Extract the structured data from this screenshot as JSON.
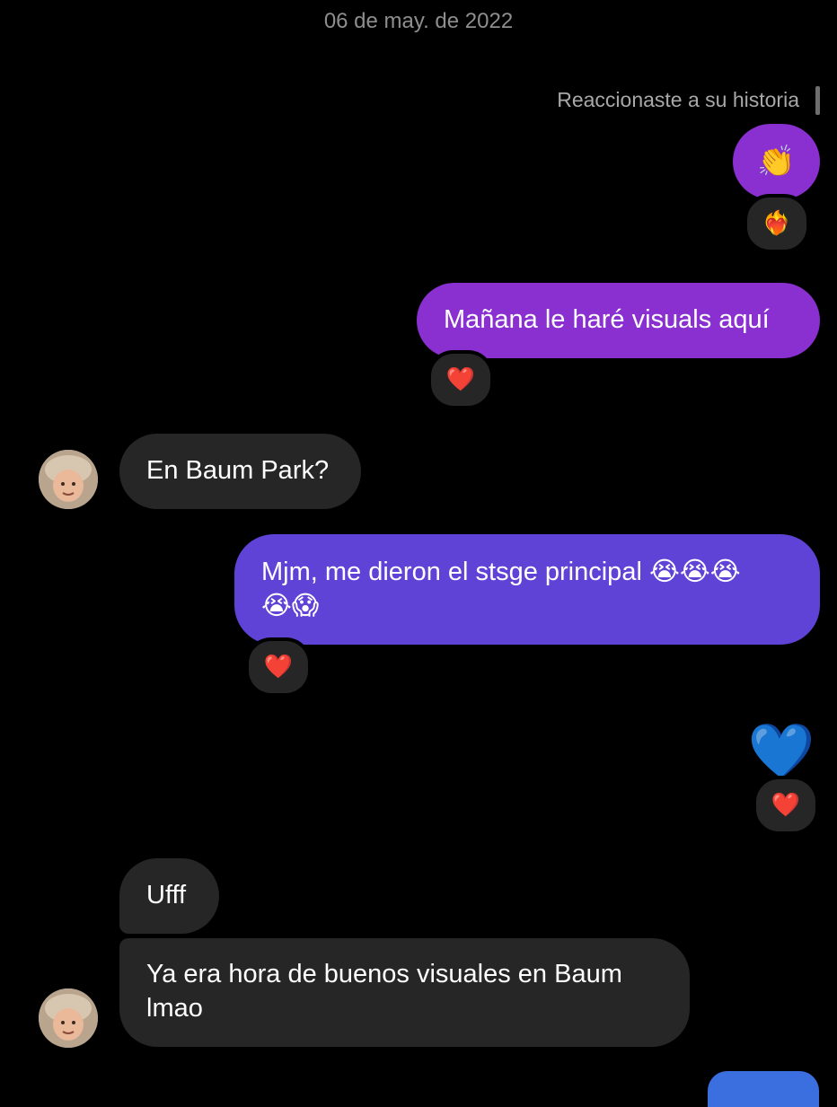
{
  "header": {
    "date": "06 de may. de 2022"
  },
  "story_reply": {
    "note": "Reaccionaste a su historia",
    "emoji": "👏",
    "reaction": "❤️‍🔥"
  },
  "messages": [
    {
      "side": "sent",
      "text": "Mañana le haré visuals aquí",
      "reaction": "❤️"
    },
    {
      "side": "received",
      "text": "En Baum Park?"
    },
    {
      "side": "sent",
      "text_line1": "Mjm, me dieron el stsge principal 😭😭😭",
      "text_line2": "😭😱",
      "reaction": "❤️"
    },
    {
      "side": "sent",
      "emoji": "💙",
      "reaction": "❤️"
    },
    {
      "side": "received",
      "text": "Ufff"
    },
    {
      "side": "received",
      "text_line1": "Ya era hora de buenos visuales en Baum",
      "text_line2": "lmao"
    }
  ],
  "colors": {
    "background": "#000000",
    "received_bubble": "#262626",
    "sent_bubble_1": "#8a2fd0",
    "sent_bubble_2": "#5f43d6",
    "date_text": "#8e8e8e"
  }
}
